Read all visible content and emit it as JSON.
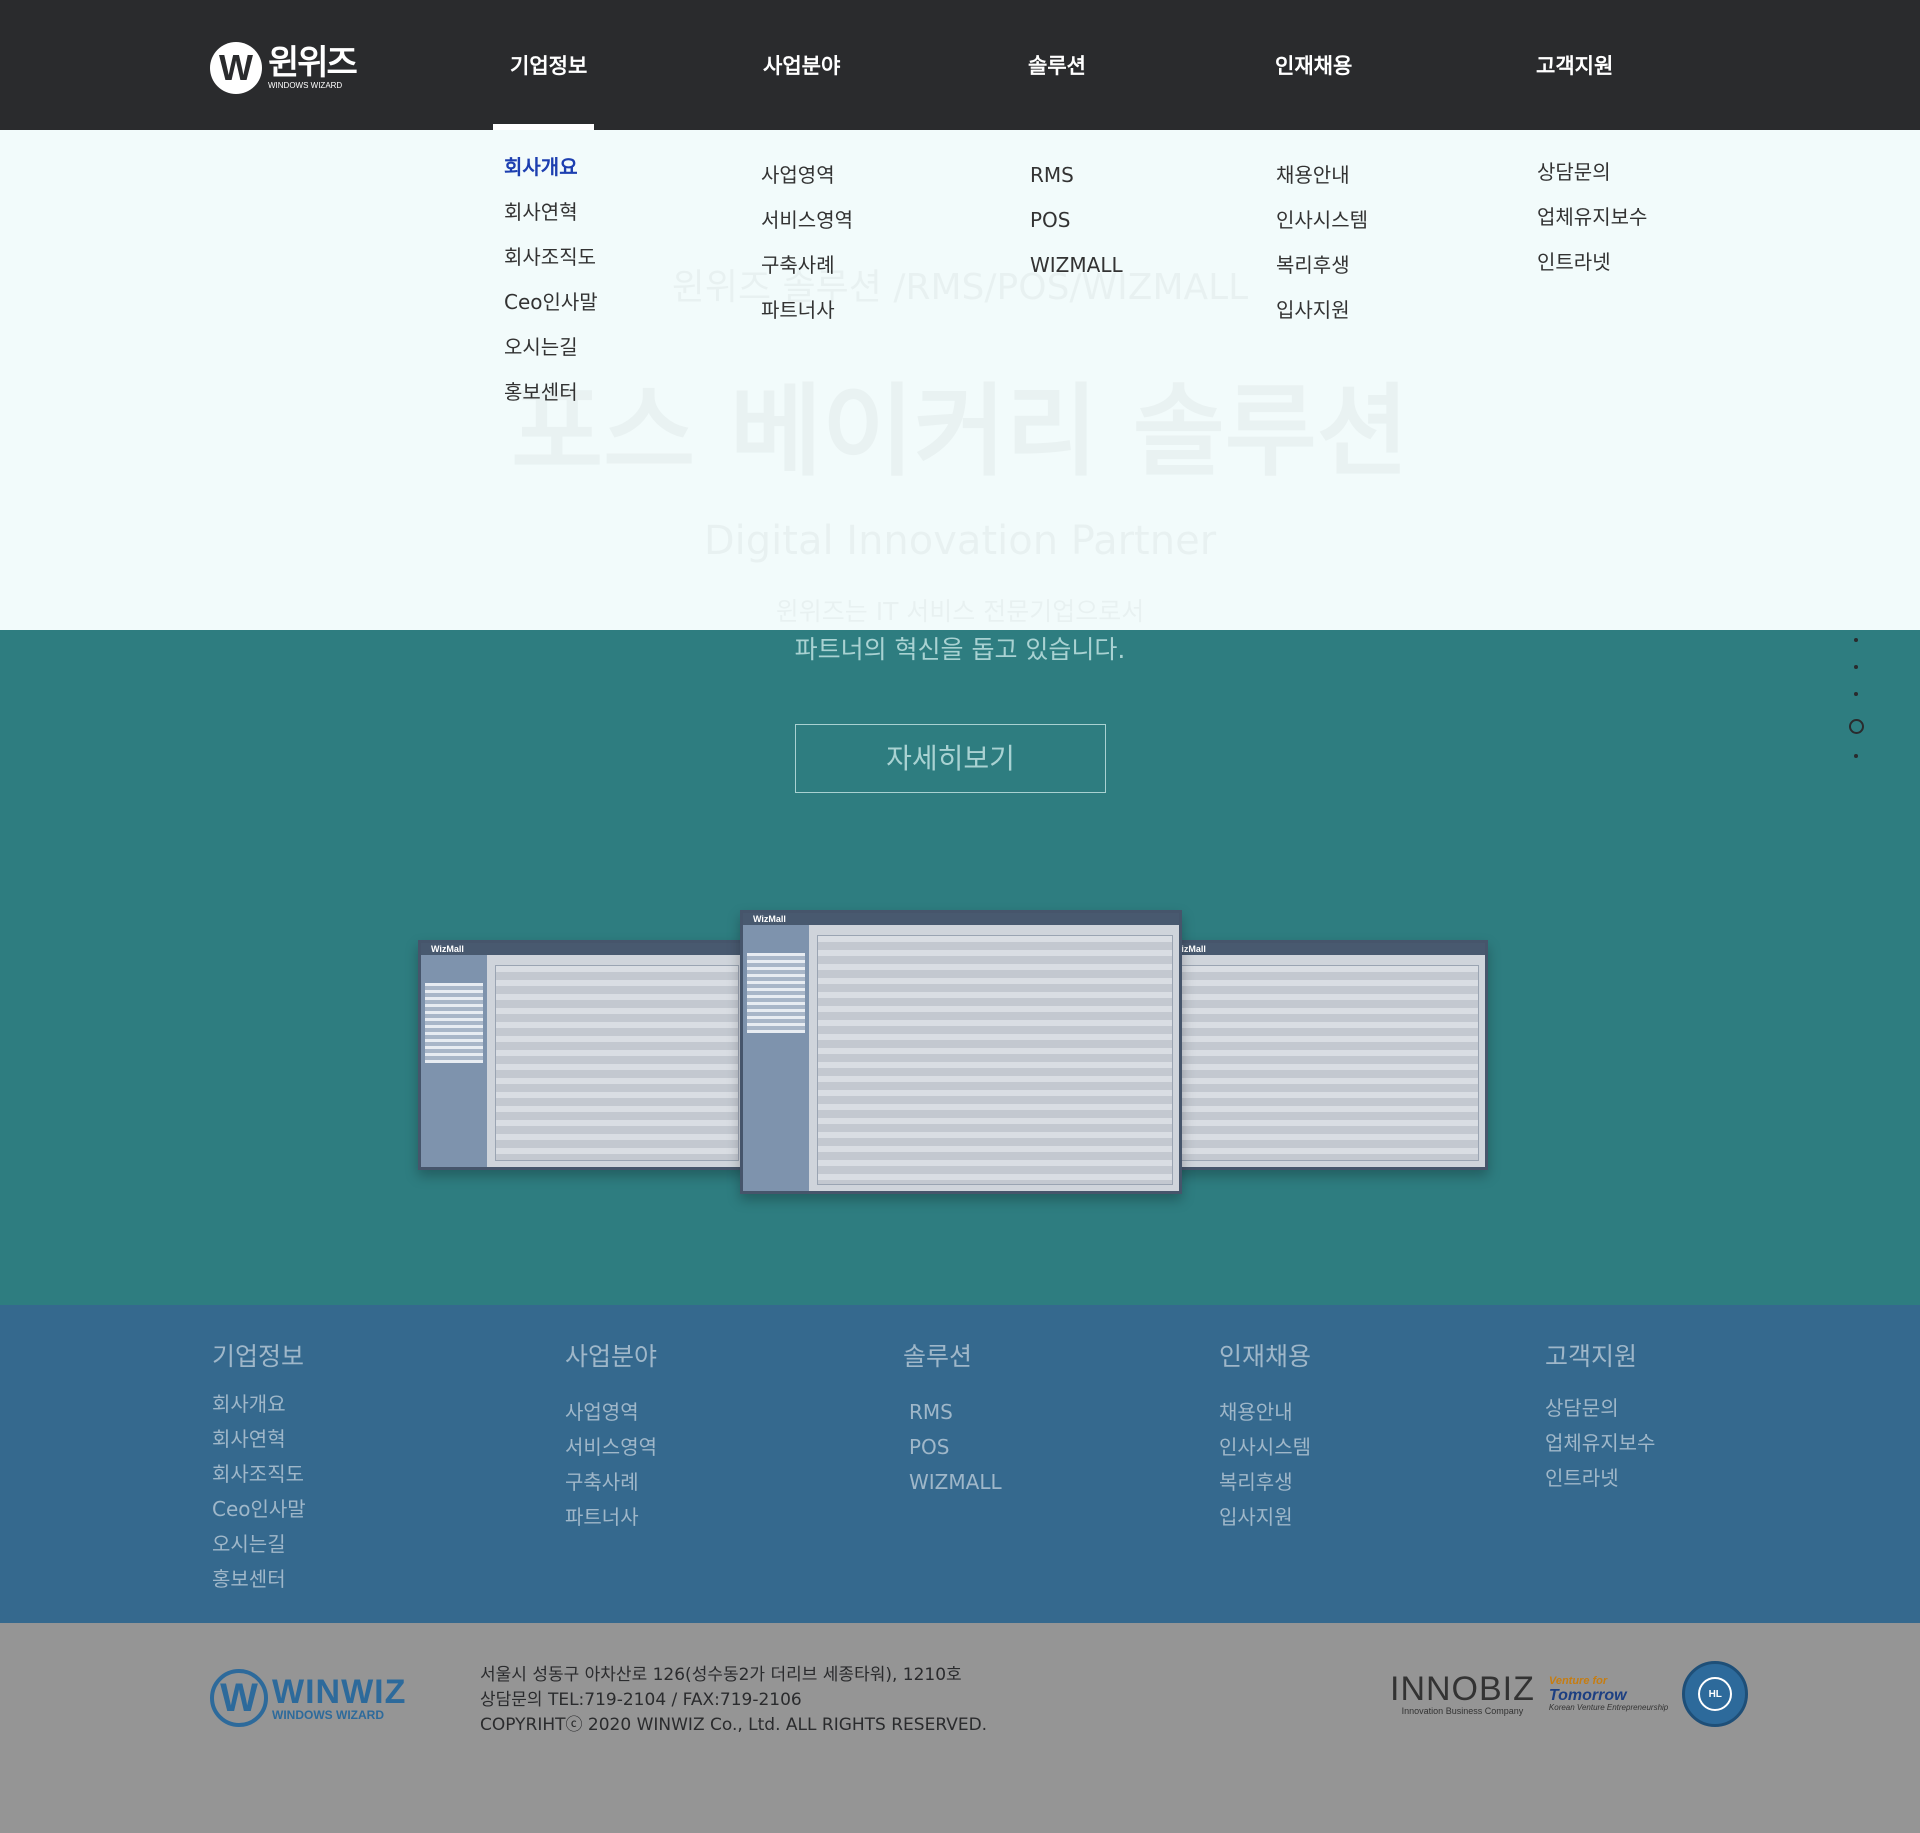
{
  "header": {
    "logo": {
      "mark": "W",
      "name": "윈위즈",
      "sub": "WINDOWS WIZARD"
    },
    "nav": [
      "기업정보",
      "사업분야",
      "솔루션",
      "인재채용",
      "고객지원"
    ]
  },
  "mega_menu": {
    "company": [
      "회사개요",
      "회사연혁",
      "회사조직도",
      "Ceo인사말",
      "오시는길",
      "홍보센터"
    ],
    "business": [
      "사업영역",
      "서비스영역",
      "구축사례",
      "파트너사"
    ],
    "solution": [
      "RMS",
      "POS",
      "WIZMALL"
    ],
    "recruit": [
      "채용안내",
      "인사시스템",
      "복리후생",
      "입사지원"
    ],
    "support": [
      "상담문의",
      "업체유지보수",
      "인트라넷"
    ]
  },
  "hero": {
    "subtitle": "윈위즈 솔루션 /RMS/POS/WIZMALL",
    "title": "포스 베이커리 솔루션",
    "tagline": "Digital Innovation Partner",
    "desc_line1": "윈위즈는 IT 서비스 전문기업으로서",
    "desc_line2": "파트너의 혁신을 돕고 있습니다.",
    "button": "자세히보기",
    "screens": [
      "WizMall",
      "WizMall",
      "WizMall"
    ]
  },
  "sitemap": [
    {
      "title": "기업정보",
      "items": [
        "회사개요",
        "회사연혁",
        "회사조직도",
        "Ceo인사말",
        "오시는길",
        "홍보센터"
      ]
    },
    {
      "title": "사업분야",
      "items": [
        "사업영역",
        "서비스영역",
        "구축사례",
        "파트너사"
      ]
    },
    {
      "title": "솔루션",
      "items": [
        "RMS",
        "POS",
        "WIZMALL"
      ]
    },
    {
      "title": "인재채용",
      "items": [
        "채용안내",
        "인사시스템",
        "복리후생",
        "입사지원"
      ]
    },
    {
      "title": "고객지원",
      "items": [
        "상담문의",
        "업체유지보수",
        "인트라넷"
      ]
    }
  ],
  "footer": {
    "logo": {
      "mark": "W",
      "name": "WINWIZ",
      "sub": "WINDOWS WIZARD"
    },
    "address": "서울시 성동구 아차산로 126(성수동2가 더리브 세종타워), 1210호",
    "contact": "상담문의 TEL:719-2104 / FAX:719-2106",
    "copyright": "COPYRIHTⓒ 2020 WINWIZ Co., Ltd. ALL RIGHTS RESERVED.",
    "certs": {
      "innobiz": "INNOBIZ",
      "innobiz_sub": "Innovation Business Company",
      "venture_l1": "Venture for",
      "venture_l2": "Tomorrow",
      "venture_l3": "Korean Venture Entrepreneurship",
      "seal": "HL"
    }
  },
  "colors": {
    "header_bg": "#2a2b2d",
    "menu_bg": "#f2fbfb",
    "active_menu": "#1d3fb0",
    "hero_bg": "#2e7d80",
    "sitemap_bg": "#35698e",
    "bottom_bg": "#959595"
  }
}
